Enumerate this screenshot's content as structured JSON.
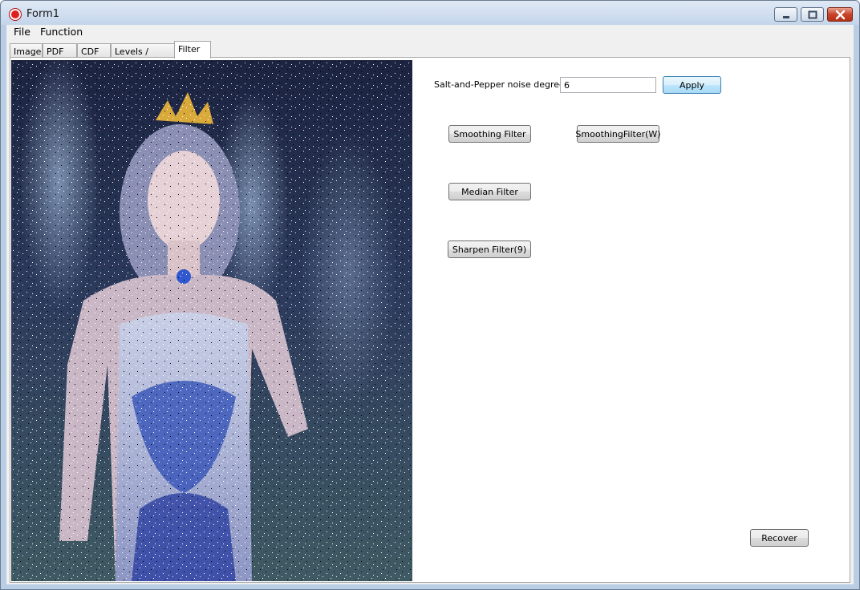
{
  "window": {
    "title": "Form1"
  },
  "menu": {
    "items": [
      "File",
      "Function"
    ]
  },
  "tabs": [
    "Image",
    "PDF",
    "CDF",
    "Levels / Curve",
    "Filter"
  ],
  "active_tab": "Filter",
  "filter_panel": {
    "noise_label": "Salt-and-Pepper noise degree :",
    "noise_value": "6",
    "apply_label": "Apply",
    "smoothing_label": "Smoothing Filter",
    "smoothing_w_label": "SmoothingFilter(W)",
    "median_label": "Median Filter",
    "sharpen_label": "Sharpen Filter(9)",
    "recover_label": "Recover"
  },
  "colors": {
    "title_bar": "#c4d5ea",
    "accent": "#3c7fb1",
    "close": "#c7432a"
  }
}
